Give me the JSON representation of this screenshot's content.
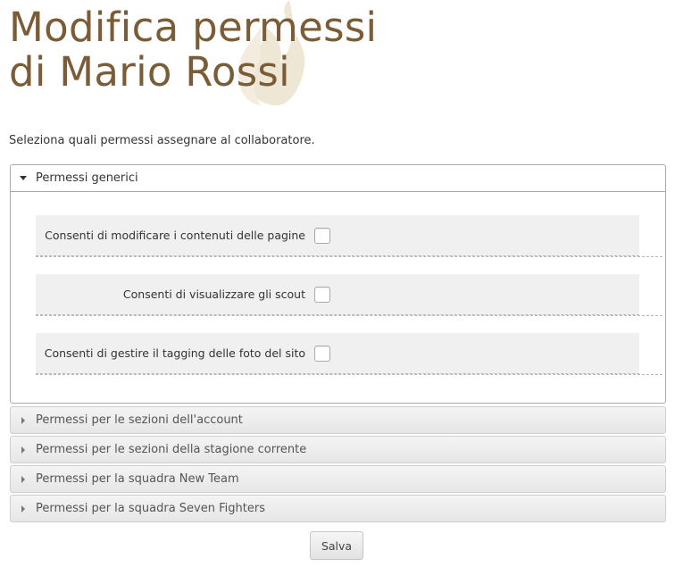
{
  "page": {
    "title_line1": "Modifica permessi",
    "title_line2": "di Mario Rossi",
    "intro": "Seleziona quali permessi assegnare al collaboratore."
  },
  "colors": {
    "title": "#7a5c37",
    "watermark": "#efe7d6"
  },
  "panels": {
    "open": {
      "label": "Permessi generici",
      "permissions": [
        {
          "label": "Consenti di modificare i contenuti delle pagine",
          "checked": false
        },
        {
          "label": "Consenti di visualizzare gli scout",
          "checked": false
        },
        {
          "label": "Consenti di gestire il tagging delle foto del sito",
          "checked": false
        }
      ]
    },
    "closed": [
      {
        "label": "Permessi per le sezioni dell'account"
      },
      {
        "label": "Permessi per le sezioni della stagione corrente"
      },
      {
        "label": "Permessi per la squadra New Team"
      },
      {
        "label": "Permessi per la squadra Seven Fighters"
      }
    ]
  },
  "actions": {
    "save_label": "Salva"
  }
}
